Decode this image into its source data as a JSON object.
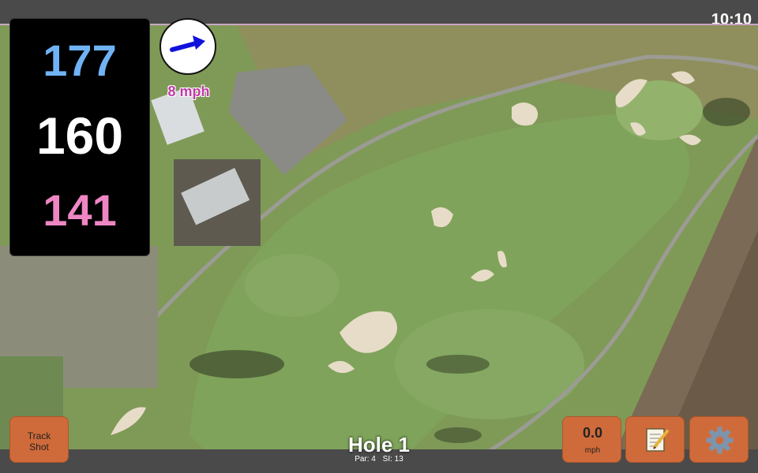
{
  "status_bar": {
    "time": "10:10"
  },
  "distances": {
    "back": "177",
    "middle": "160",
    "front": "141"
  },
  "wind": {
    "speed_label": "8 mph",
    "direction_icon": "arrow-icon"
  },
  "buttons": {
    "track_shot": "Track\nShot",
    "wind_value": "0.0",
    "wind_unit": "mph",
    "notes_icon": "notepad-icon",
    "settings_icon": "gear-icon"
  },
  "hole": {
    "title": "Hole 1",
    "par": "Par: 4",
    "si": "SI: 13"
  },
  "colors": {
    "back": "#6fb3f5",
    "middle": "#ffffff",
    "front": "#ef86c4",
    "button": "#cf6b3a",
    "wind_text": "#c23aa6"
  }
}
